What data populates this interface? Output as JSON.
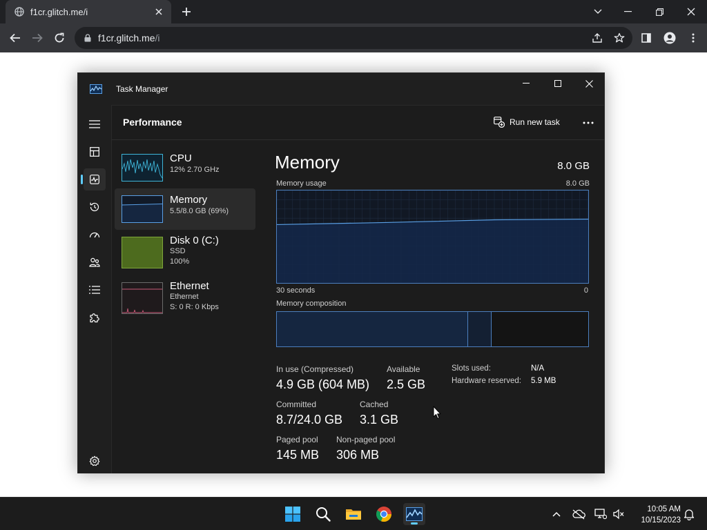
{
  "browser": {
    "tab_title": "f1cr.glitch.me/i",
    "url_host": "f1cr.glitch.me",
    "url_path": "/i"
  },
  "taskmanager": {
    "window_title": "Task Manager",
    "page_title": "Performance",
    "run_new_task_label": "Run new task",
    "resources": [
      {
        "name": "CPU",
        "sub1": "12%  2.70 GHz",
        "sub2": "",
        "sub3": ""
      },
      {
        "name": "Memory",
        "sub1": "5.5/8.0 GB (69%)",
        "sub2": "",
        "sub3": ""
      },
      {
        "name": "Disk 0 (C:)",
        "sub1": "SSD",
        "sub2": "100%",
        "sub3": ""
      },
      {
        "name": "Ethernet",
        "sub1": "Ethernet",
        "sub2": "S: 0  R: 0 Kbps",
        "sub3": ""
      }
    ],
    "detail": {
      "title": "Memory",
      "total": "8.0 GB",
      "usage_label": "Memory usage",
      "usage_max": "8.0 GB",
      "time_left": "30 seconds",
      "time_right": "0",
      "composition_label": "Memory composition",
      "usage_fraction": 0.69,
      "in_use_label": "In use (Compressed)",
      "in_use_value": "4.9 GB (604 MB)",
      "available_label": "Available",
      "available_value": "2.5 GB",
      "committed_label": "Committed",
      "committed_value": "8.7/24.0 GB",
      "cached_label": "Cached",
      "cached_value": "3.1 GB",
      "paged_label": "Paged pool",
      "paged_value": "145 MB",
      "nonpaged_label": "Non-paged pool",
      "nonpaged_value": "306 MB",
      "slots_label": "Slots used:",
      "slots_value": "N/A",
      "hwres_label": "Hardware reserved:",
      "hwres_value": "5.9 MB"
    }
  },
  "taskbar": {
    "time": "10:05 AM",
    "date": "10/15/2023"
  },
  "colors": {
    "accent": "#60cdff",
    "memory_line": "#5aa0e6",
    "cpu_line": "#3fb6d9",
    "disk_fill": "#4d6b1e",
    "ethernet_line": "#c85a78"
  }
}
